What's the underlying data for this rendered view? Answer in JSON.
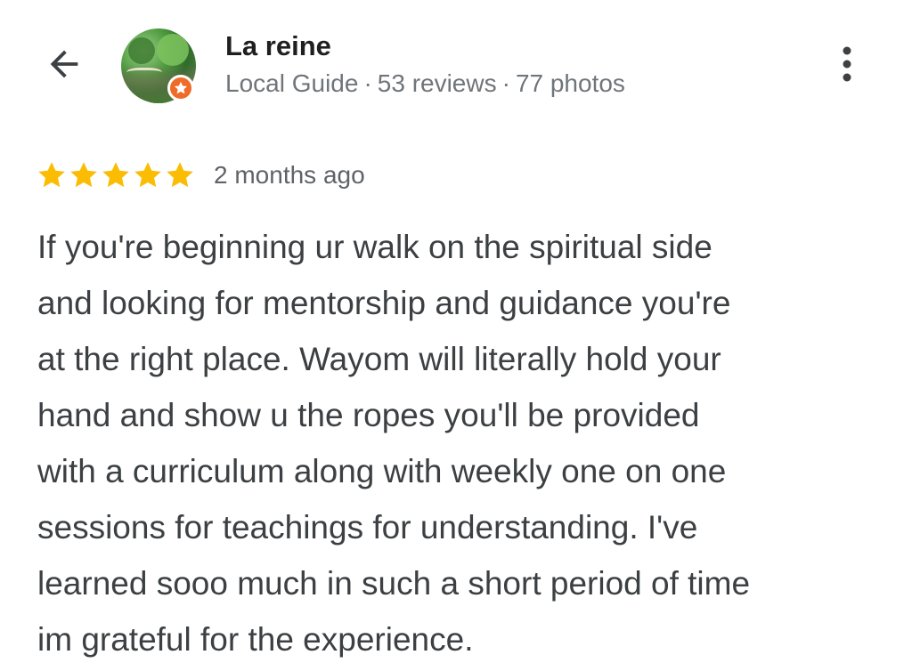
{
  "header": {
    "back_icon": "arrow-back-icon",
    "reviewer_name": "La reine",
    "reviewer_badge_icon": "local-guide-star-badge-icon",
    "meta": {
      "level": "Local Guide",
      "separator": "·",
      "reviews": "53 reviews",
      "photos": "77 photos"
    },
    "more_icon": "more-vert-icon"
  },
  "review": {
    "rating": 5,
    "rating_max": 5,
    "star_icon": "star-icon",
    "date": "2 months ago",
    "text_lines": [
      "If you're beginning ur walk on the spiritual side",
      "and looking for mentorship and guidance you're",
      "at the right place. Wayom will literally hold your",
      "hand and show u the ropes you'll be provided",
      "with a curriculum along with weekly one on one",
      "sessions for teachings for understanding. I've",
      "learned sooo much in such a short period of time",
      "im grateful for the experience."
    ]
  },
  "colors": {
    "star": "#FBBC04",
    "badge": "#EF6C28",
    "name": "#1F1F1F",
    "meta": "#70757A",
    "body_text": "#3C4043",
    "icon": "#5F6368"
  }
}
